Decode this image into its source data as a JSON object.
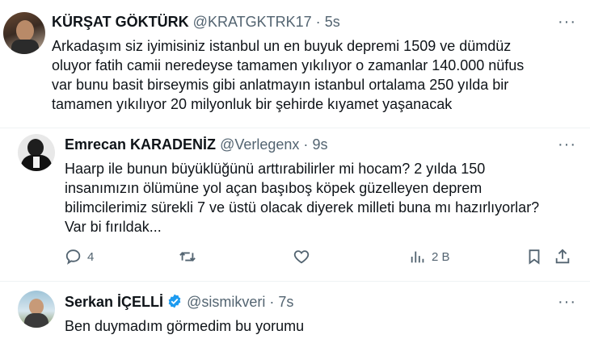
{
  "tweets": [
    {
      "display_name": "KÜRŞAT GÖKTÜRK",
      "handle": "@KRATGKTRK17",
      "sep": "·",
      "time": "5s",
      "lines": [
        "Arkadaşım siz iyimisiniz istanbul un en buyuk depremi 1509 ve dümdüz",
        "oluyor fatih camii neredeyse tamamen yıkılıyor o zamanlar 140.000 nüfus",
        "var  bunu basit birseymis gibi anlatmayın istanbul ortalama 250 yılda bir",
        "tamamen yıkılıyor 20 milyonluk bir şehirde kıyamet yaşanacak"
      ]
    },
    {
      "display_name": "Emrecan KARADENİZ",
      "handle": "@Verlegenx",
      "sep": "·",
      "time": "9s",
      "lines": [
        "Haarp ile bunun büyüklüğünü arttırabilirler mi hocam? 2 yılda 150",
        "insanımızın ölümüne yol açan başıboş köpek güzelleyen deprem",
        "bilimcilerimiz sürekli 7 ve üstü olacak diyerek milleti buna mı hazırlıyorlar?",
        "Var bi fırıldak..."
      ],
      "actions": {
        "reply_count": "4",
        "retweet_count": "",
        "like_count": "",
        "views_count": "2 B"
      }
    },
    {
      "display_name": "Serkan İÇELLİ",
      "handle": "@sismikveri",
      "sep": "·",
      "time": "7s",
      "lines": [
        "Ben duymadım görmedim bu yorumu"
      ]
    }
  ],
  "more_label": "···",
  "colors": {
    "text": "#0f1419",
    "meta": "#536471",
    "verified": "#1d9bf0",
    "thread_line": "#cfd9de",
    "divider": "#eff3f4"
  },
  "icons": [
    "more-icon",
    "reply-icon",
    "retweet-icon",
    "like-icon",
    "views-icon",
    "bookmark-icon",
    "share-icon",
    "verified-badge-icon"
  ]
}
